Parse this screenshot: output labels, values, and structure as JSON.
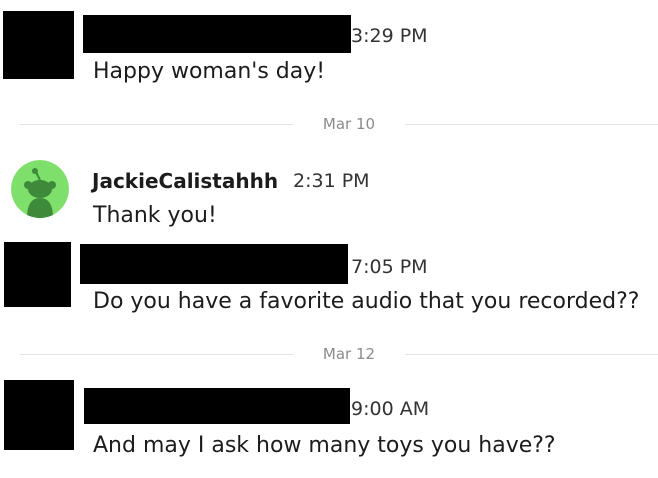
{
  "colors": {
    "redaction": "#000000",
    "avatar_bg": "#7ee06b",
    "avatar_figure": "#3c8a3a",
    "divider_line": "#e3e3e3",
    "divider_text": "#8b8b8b"
  },
  "messages": [
    {
      "time": "3:29 PM",
      "text": "Happy woman's day!"
    },
    {
      "username": "JackieCalistahhh",
      "time": "2:31 PM",
      "text": "Thank you!",
      "avatar_icon": "snoo-avatar-icon"
    },
    {
      "time": "7:05 PM",
      "text": "Do you have a favorite audio that you recorded??"
    },
    {
      "time": "9:00 AM",
      "text": "And may I ask how many toys you have??"
    }
  ],
  "dividers": [
    {
      "label": "Mar 10"
    },
    {
      "label": "Mar 12"
    }
  ]
}
